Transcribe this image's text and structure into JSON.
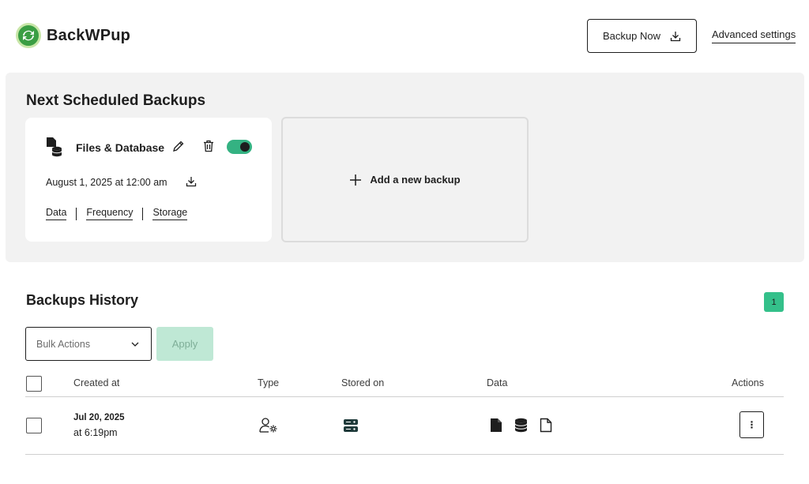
{
  "app": {
    "name": "BackWPup"
  },
  "header": {
    "backup_now_label": "Backup Now",
    "advanced_settings_label": "Advanced settings"
  },
  "scheduled": {
    "title": "Next Scheduled Backups",
    "jobs": [
      {
        "title": "Files & Database",
        "date": "August 1, 2025 at 12:00 am",
        "enabled": true,
        "links": [
          "Data",
          "Frequency",
          "Storage"
        ]
      }
    ],
    "add_label": "Add a new backup"
  },
  "history": {
    "title": "Backups History",
    "page": "1",
    "bulk_actions_placeholder": "Bulk Actions",
    "apply_label": "Apply",
    "columns": {
      "created_at": "Created at",
      "type": "Type",
      "stored_on": "Stored on",
      "data": "Data",
      "actions": "Actions"
    },
    "rows": [
      {
        "date": "Jul 20, 2025",
        "time": "at 6:19pm",
        "type_icon": "user-gear-icon",
        "stored_icon": "server-icon",
        "data_icons": [
          "file-solid-icon",
          "database-icon",
          "file-outline-icon"
        ],
        "actions_glyph": "⋮"
      }
    ]
  },
  "colors": {
    "accent": "#34b282",
    "brand_green": "#3a9e43",
    "panel_bg": "#f2f2f2",
    "apply_disabled": "#bfe8d5"
  }
}
